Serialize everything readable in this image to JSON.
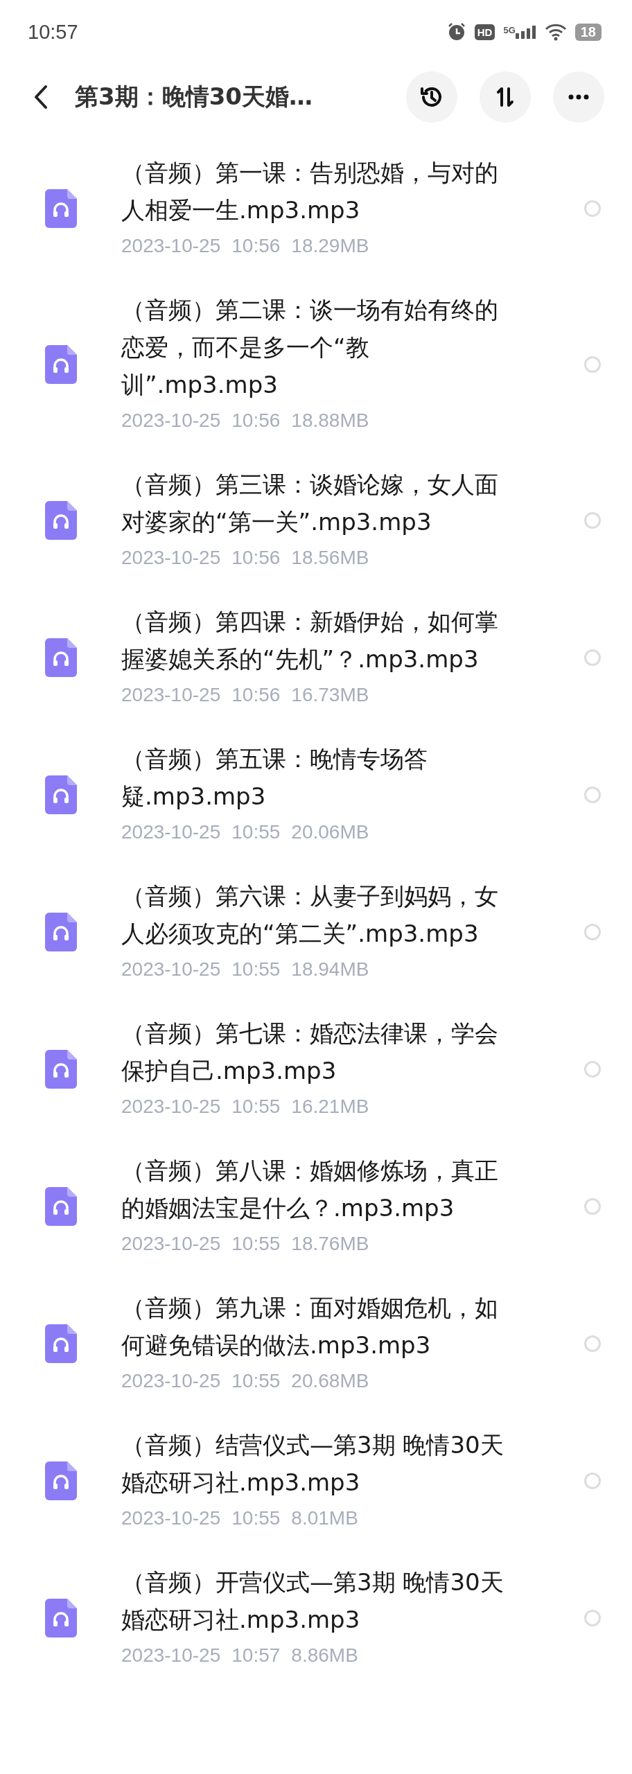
{
  "status_bar": {
    "time": "10:57",
    "battery": "18",
    "network": "5G",
    "hd": "HD"
  },
  "header": {
    "title": "第3期：晚情30天婚…"
  },
  "files": [
    {
      "name": "（音频）第一课：告别恐婚，与对的人相爱一生.mp3.mp3",
      "date": "2023-10-25",
      "time": "10:56",
      "size": "18.29MB",
      "selected": false
    },
    {
      "name": "（音频）第二课：谈一场有始有终的恋爱，而不是多一个“教训”.mp3.mp3",
      "date": "2023-10-25",
      "time": "10:56",
      "size": "18.88MB",
      "selected": false
    },
    {
      "name": "（音频）第三课：谈婚论嫁，女人面对婆家的“第一关”.mp3.mp3",
      "date": "2023-10-25",
      "time": "10:56",
      "size": "18.56MB",
      "selected": false
    },
    {
      "name": "（音频）第四课：新婚伊始，如何掌握婆媳关系的“先机”？.mp3.mp3",
      "date": "2023-10-25",
      "time": "10:56",
      "size": "16.73MB",
      "selected": false
    },
    {
      "name": "（音频）第五课：晚情专场答疑.mp3.mp3",
      "date": "2023-10-25",
      "time": "10:55",
      "size": "20.06MB",
      "selected": false
    },
    {
      "name": "（音频）第六课：从妻子到妈妈，女人必须攻克的“第二关”.mp3.mp3",
      "date": "2023-10-25",
      "time": "10:55",
      "size": "18.94MB",
      "selected": false
    },
    {
      "name": "（音频）第七课：婚恋法律课，学会保护自己.mp3.mp3",
      "date": "2023-10-25",
      "time": "10:55",
      "size": "16.21MB",
      "selected": false
    },
    {
      "name": "（音频）第八课：婚姻修炼场，真正的婚姻法宝是什么？.mp3.mp3",
      "date": "2023-10-25",
      "time": "10:55",
      "size": "18.76MB",
      "selected": false
    },
    {
      "name": "（音频）第九课：面对婚姻危机，如何避免错误的做法.mp3.mp3",
      "date": "2023-10-25",
      "time": "10:55",
      "size": "20.68MB",
      "selected": false
    },
    {
      "name": "（音频）结营仪式—第3期 晚情30天婚恋研习社.mp3.mp3",
      "date": "2023-10-25",
      "time": "10:55",
      "size": "8.01MB",
      "selected": false
    },
    {
      "name": "（音频）开营仪式—第3期 晚情30天婚恋研习社.mp3.mp3",
      "date": "2023-10-25",
      "time": "10:57",
      "size": "8.86MB",
      "selected": false
    }
  ]
}
